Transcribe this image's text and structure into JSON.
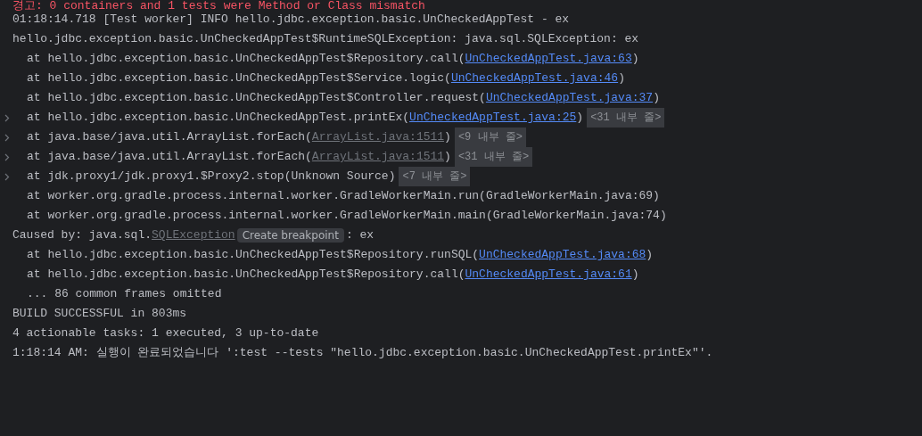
{
  "console": {
    "lines": [
      {
        "kind": "warning",
        "expandable": false,
        "segments": [
          {
            "kind": "plain",
            "text": "경고: 0 containers and 1 tests were Method or Class mismatch"
          }
        ]
      },
      {
        "kind": "log",
        "expandable": false,
        "segments": [
          {
            "kind": "plain",
            "text": "01:18:14.718 [Test worker] INFO hello.jdbc.exception.basic.UnCheckedAppTest - ex"
          }
        ]
      },
      {
        "kind": "log",
        "expandable": false,
        "segments": [
          {
            "kind": "plain",
            "text": "hello.jdbc.exception.basic.UnCheckedAppTest$RuntimeSQLException: java.sql.SQLException: ex"
          }
        ]
      },
      {
        "kind": "frame",
        "expandable": false,
        "segments": [
          {
            "kind": "plain",
            "text": "at hello.jdbc.exception.basic.UnCheckedAppTest$Repository.call("
          },
          {
            "kind": "link",
            "text": "UnCheckedAppTest.java:63"
          },
          {
            "kind": "plain",
            "text": ")"
          }
        ]
      },
      {
        "kind": "frame",
        "expandable": false,
        "segments": [
          {
            "kind": "plain",
            "text": "at hello.jdbc.exception.basic.UnCheckedAppTest$Service.logic("
          },
          {
            "kind": "link",
            "text": "UnCheckedAppTest.java:46"
          },
          {
            "kind": "plain",
            "text": ")"
          }
        ]
      },
      {
        "kind": "frame",
        "expandable": false,
        "segments": [
          {
            "kind": "plain",
            "text": "at hello.jdbc.exception.basic.UnCheckedAppTest$Controller.request("
          },
          {
            "kind": "link",
            "text": "UnCheckedAppTest.java:37"
          },
          {
            "kind": "plain",
            "text": ")"
          }
        ]
      },
      {
        "kind": "frame",
        "expandable": true,
        "segments": [
          {
            "kind": "plain",
            "text": "at hello.jdbc.exception.basic.UnCheckedAppTest.printEx("
          },
          {
            "kind": "link",
            "text": "UnCheckedAppTest.java:25"
          },
          {
            "kind": "plain",
            "text": ")"
          },
          {
            "kind": "fold",
            "text": "<31 내부 줄>"
          }
        ]
      },
      {
        "kind": "frame",
        "expandable": true,
        "segments": [
          {
            "kind": "plain",
            "text": "at java.base/java.util.ArrayList.forEach("
          },
          {
            "kind": "dim-link",
            "text": "ArrayList.java:1511"
          },
          {
            "kind": "plain",
            "text": ")"
          },
          {
            "kind": "fold",
            "text": "<9 내부 줄>"
          }
        ]
      },
      {
        "kind": "frame",
        "expandable": true,
        "segments": [
          {
            "kind": "plain",
            "text": "at java.base/java.util.ArrayList.forEach("
          },
          {
            "kind": "dim-link",
            "text": "ArrayList.java:1511"
          },
          {
            "kind": "plain",
            "text": ")"
          },
          {
            "kind": "fold",
            "text": "<31 내부 줄>"
          }
        ]
      },
      {
        "kind": "frame",
        "expandable": true,
        "segments": [
          {
            "kind": "plain",
            "text": "at jdk.proxy1/jdk.proxy1.$Proxy2.stop(Unknown Source)"
          },
          {
            "kind": "fold",
            "text": "<7 내부 줄>"
          }
        ]
      },
      {
        "kind": "frame",
        "expandable": false,
        "segments": [
          {
            "kind": "plain",
            "text": "at worker.org.gradle.process.internal.worker.GradleWorkerMain.run(GradleWorkerMain.java:69)"
          }
        ]
      },
      {
        "kind": "frame",
        "expandable": false,
        "segments": [
          {
            "kind": "plain",
            "text": "at worker.org.gradle.process.internal.worker.GradleWorkerMain.main(GradleWorkerMain.java:74)"
          }
        ]
      },
      {
        "kind": "log",
        "expandable": false,
        "segments": [
          {
            "kind": "plain",
            "text": "Caused by: java.sql."
          },
          {
            "kind": "dim-link",
            "text": "SQLException"
          },
          {
            "kind": "tooltip",
            "text": "Create breakpoint"
          },
          {
            "kind": "plain",
            "text": ": ex"
          }
        ]
      },
      {
        "kind": "frame",
        "expandable": false,
        "segments": [
          {
            "kind": "plain",
            "text": "at hello.jdbc.exception.basic.UnCheckedAppTest$Repository.runSQL("
          },
          {
            "kind": "link",
            "text": "UnCheckedAppTest.java:68"
          },
          {
            "kind": "plain",
            "text": ")"
          }
        ]
      },
      {
        "kind": "frame",
        "expandable": false,
        "segments": [
          {
            "kind": "plain",
            "text": "at hello.jdbc.exception.basic.UnCheckedAppTest$Repository.call("
          },
          {
            "kind": "link",
            "text": "UnCheckedAppTest.java:61"
          },
          {
            "kind": "plain",
            "text": ")"
          }
        ]
      },
      {
        "kind": "frame",
        "expandable": false,
        "segments": [
          {
            "kind": "plain",
            "text": "... 86 common frames omitted"
          }
        ]
      },
      {
        "kind": "log",
        "expandable": false,
        "segments": [
          {
            "kind": "plain",
            "text": "BUILD SUCCESSFUL in 803ms"
          }
        ]
      },
      {
        "kind": "log",
        "expandable": false,
        "segments": [
          {
            "kind": "plain",
            "text": "4 actionable tasks: 1 executed, 3 up-to-date"
          }
        ]
      },
      {
        "kind": "log",
        "expandable": false,
        "segments": [
          {
            "kind": "plain",
            "text": "1:18:14 AM: 실행이 완료되었습니다 ':test --tests \"hello.jdbc.exception.basic.UnCheckedAppTest.printEx\"'."
          }
        ]
      }
    ]
  }
}
